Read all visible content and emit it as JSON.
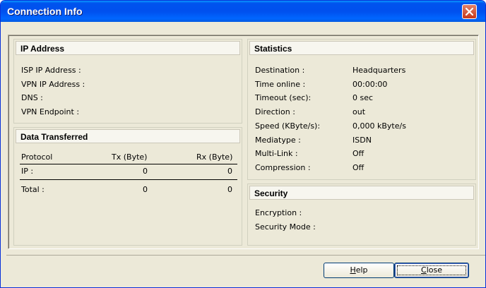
{
  "window": {
    "title": "Connection Info"
  },
  "ip_address": {
    "title": "IP Address",
    "labels": [
      "ISP IP Address :",
      "VPN IP Address :",
      "DNS :",
      "VPN Endpoint :"
    ]
  },
  "data_transferred": {
    "title": "Data Transferred",
    "columns": [
      "Protocol",
      "Tx (Byte)",
      "Rx (Byte)"
    ],
    "rows": [
      {
        "label": "IP :",
        "tx": "0",
        "rx": "0"
      },
      {
        "label": "Total :",
        "tx": "0",
        "rx": "0"
      }
    ]
  },
  "statistics": {
    "title": "Statistics",
    "rows": [
      {
        "label": "Destination :",
        "value": "Headquarters"
      },
      {
        "label": "Time online :",
        "value": "00:00:00"
      },
      {
        "label": "Timeout (sec):",
        "value": "0  sec"
      },
      {
        "label": "Direction :",
        "value": "out"
      },
      {
        "label": "Speed (KByte/s):",
        "value": "0,000  kByte/s"
      },
      {
        "label": "Mediatype :",
        "value": "ISDN"
      },
      {
        "label": "Multi-Link :",
        "value": "Off"
      },
      {
        "label": "Compression :",
        "value": "Off"
      }
    ]
  },
  "security": {
    "title": "Security",
    "labels": [
      "Encryption :",
      "Security Mode :"
    ]
  },
  "buttons": {
    "help_prefix": "",
    "help_mnemonic": "H",
    "help_rest": "elp",
    "close_mnemonic": "C",
    "close_rest": "lose"
  },
  "colors": {
    "titlebar": "#0054e3",
    "close": "#c7391b",
    "face": "#ece9d8"
  },
  "icons": {
    "close": "close-icon"
  }
}
